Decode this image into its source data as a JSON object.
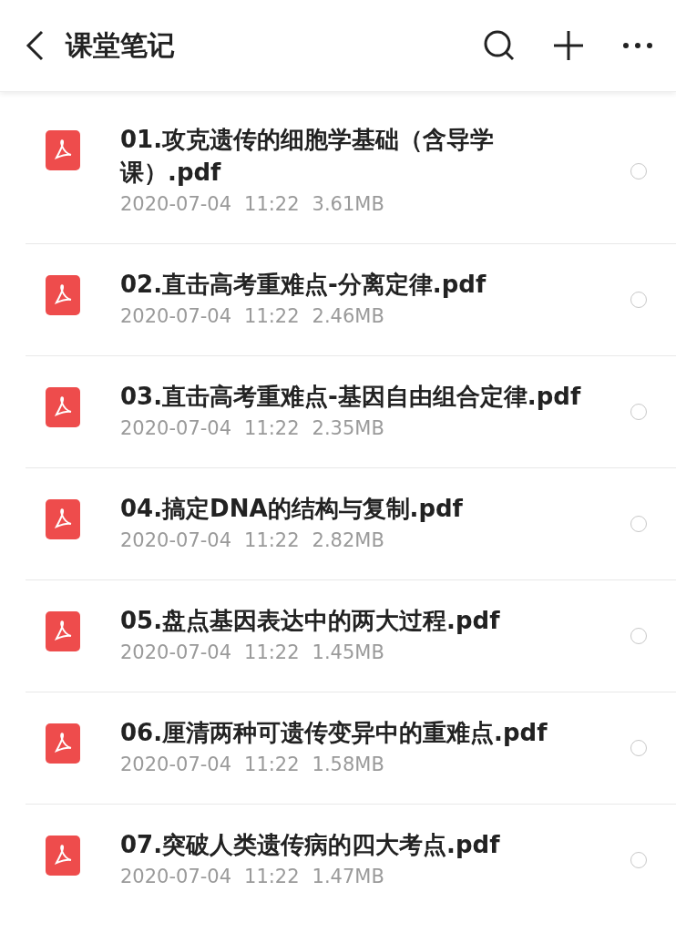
{
  "header": {
    "title": "课堂笔记"
  },
  "files": [
    {
      "name": "01.攻克遗传的细胞学基础（含导学课）.pdf",
      "date": "2020-07-04",
      "time": "11:22",
      "size": "3.61MB",
      "selected": false
    },
    {
      "name": "02.直击高考重难点-分离定律.pdf",
      "date": "2020-07-04",
      "time": "11:22",
      "size": "2.46MB",
      "selected": false
    },
    {
      "name": "03.直击高考重难点-基因自由组合定律.pdf",
      "date": "2020-07-04",
      "time": "11:22",
      "size": "2.35MB",
      "selected": false
    },
    {
      "name": "04.搞定DNA的结构与复制.pdf",
      "date": "2020-07-04",
      "time": "11:22",
      "size": "2.82MB",
      "selected": false
    },
    {
      "name": "05.盘点基因表达中的两大过程.pdf",
      "date": "2020-07-04",
      "time": "11:22",
      "size": "1.45MB",
      "selected": false
    },
    {
      "name": "06.厘清两种可遗传变异中的重难点.pdf",
      "date": "2020-07-04",
      "time": "11:22",
      "size": "1.58MB",
      "selected": false
    },
    {
      "name": "07.突破人类遗传病的四大考点.pdf",
      "date": "2020-07-04",
      "time": "11:22",
      "size": "1.47MB",
      "selected": false
    }
  ]
}
